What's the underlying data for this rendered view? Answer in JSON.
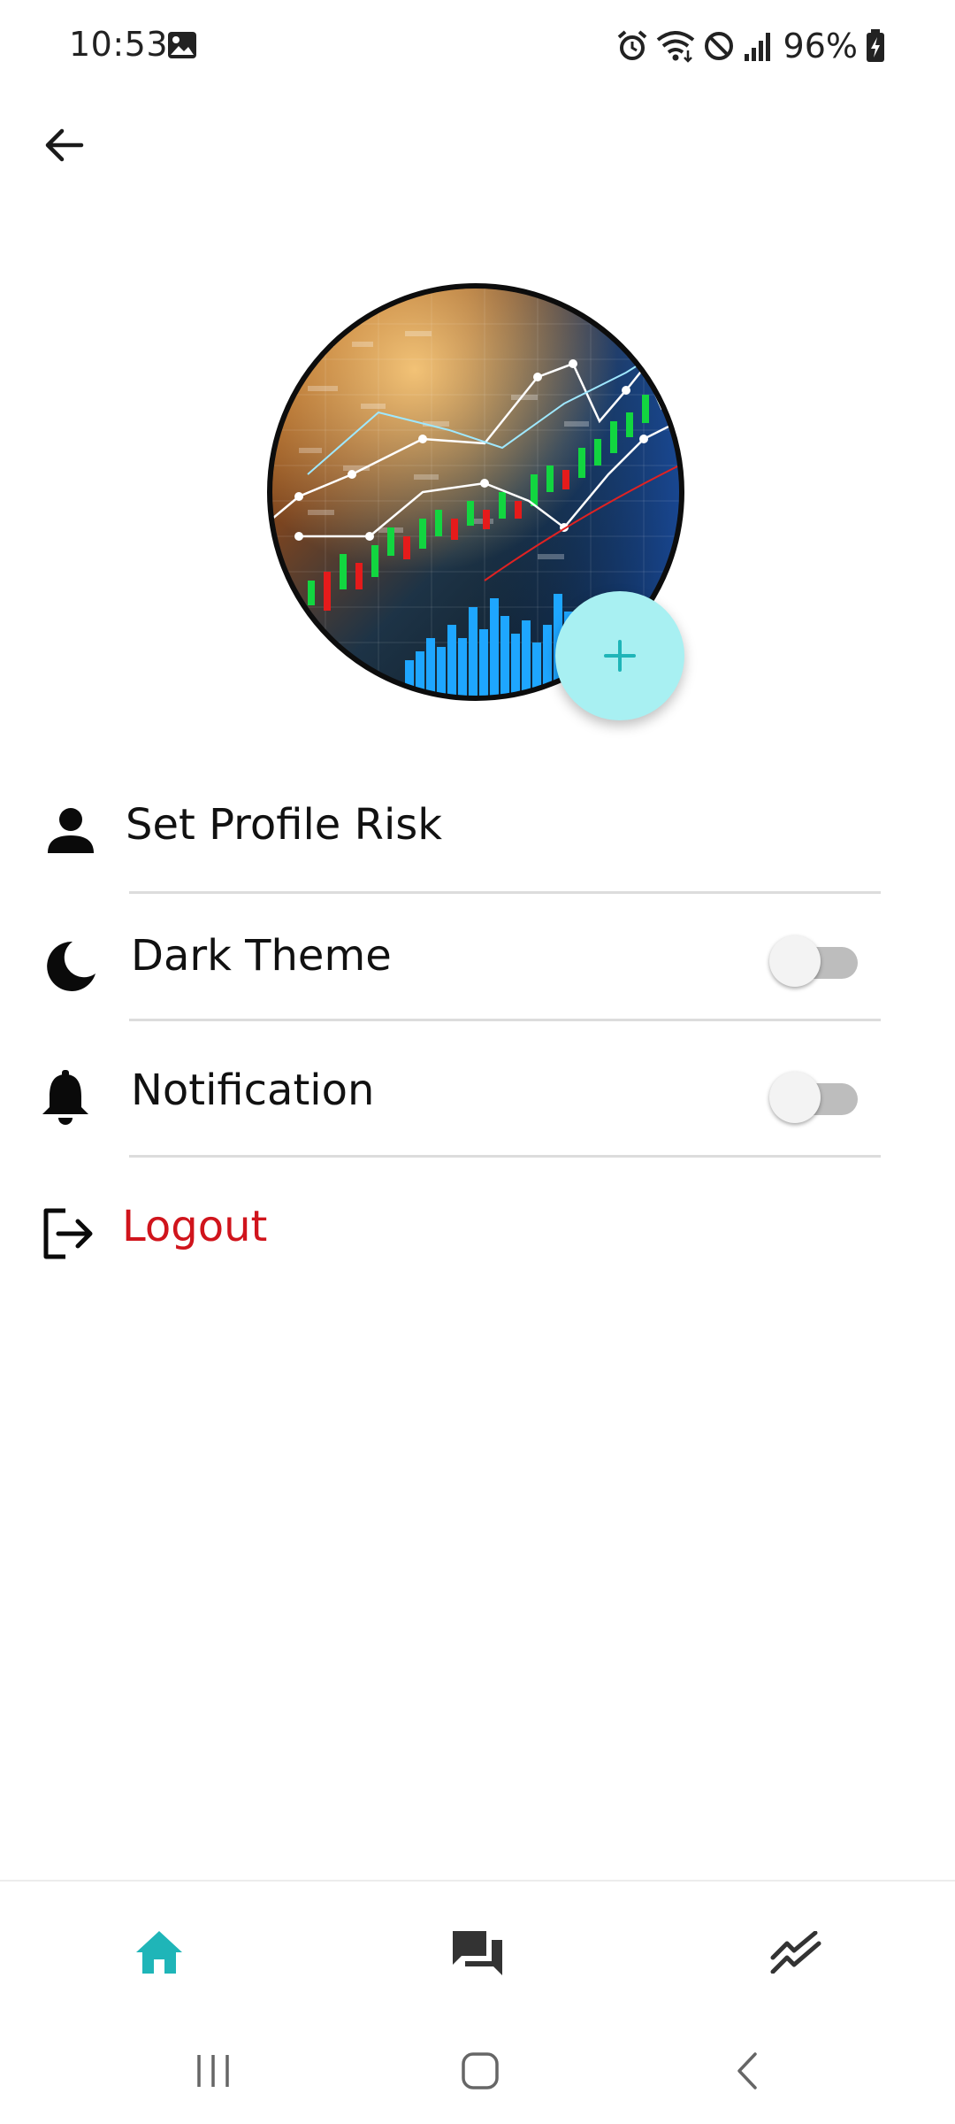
{
  "status_bar": {
    "time": "10:53",
    "battery": "96%",
    "icons": [
      "gallery-icon",
      "alarm-icon",
      "wifi-icon",
      "do-not-disturb-icon",
      "signal-icon",
      "battery-charging-icon"
    ]
  },
  "header": {
    "back_icon": "arrow-back-icon"
  },
  "profile": {
    "avatar_image": "stock-market-chart",
    "add_icon": "plus-icon",
    "accent_color": "#1fb5b8",
    "fab_color": "#a8f0f2"
  },
  "menu": {
    "set_profile_risk": "Set Profile Risk",
    "dark_theme": "Dark Theme",
    "dark_theme_enabled": false,
    "notification": "Notification",
    "notification_enabled": false,
    "logout": "Logout",
    "logout_color": "#d0141c"
  },
  "bottom_nav": {
    "items": [
      "home-icon",
      "forum-icon",
      "trending-icon"
    ],
    "active": "home-icon",
    "active_color": "#1fb5b8"
  },
  "system_nav": {
    "items": [
      "recent-apps-icon",
      "home-button-icon",
      "back-system-icon"
    ]
  }
}
